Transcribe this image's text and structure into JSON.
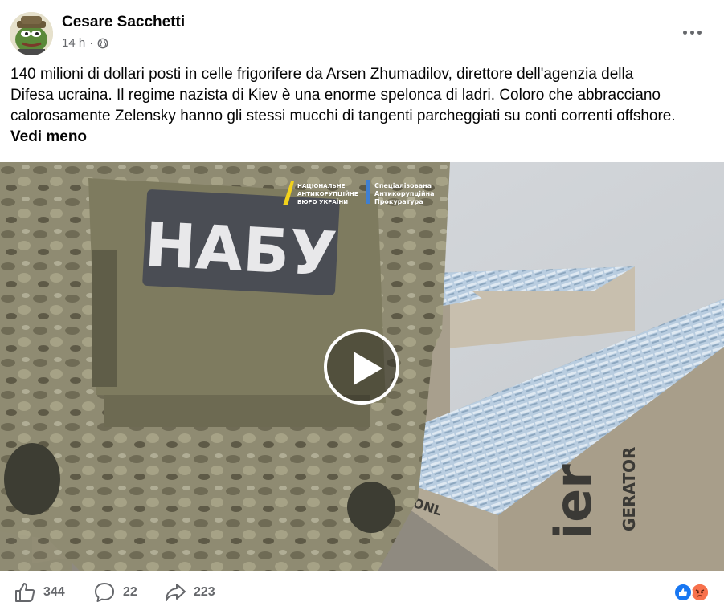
{
  "post": {
    "author": "Cesare Sacchetti",
    "time": "14 h",
    "separator": "·",
    "privacy_icon": "globe-icon",
    "more_icon": "more-horizontal-icon",
    "text_lines": [
      "140 milioni di dollari posti in celle frigorifere da Arsen Zhumadilov, direttore dell'agenzia della",
      "Difesa ucraina. Il regime nazista di Kiev è una enorme spelonca di ladri. Coloro che abbracciano",
      "calorosamente Zelensky hanno gli stessi mucchi di tangenti parcheggiati su conti correnti offshore."
    ],
    "see_less": "Vedi meno"
  },
  "video": {
    "patch_text": "НАБУ",
    "logo1_lines": [
      "НАЦІОНАЛЬНЕ",
      "АНТИКОРУПЦІЙНЕ",
      "БЮРО УКРАЇНИ"
    ],
    "logo2_lines": [
      "Спеціалізована",
      "Антикорупційна",
      "Прокуратура"
    ],
    "box_text_1": "DONL",
    "box_text_2": "ier",
    "box_text_3": "GERATOR",
    "play_icon": "play-icon"
  },
  "actions": {
    "likes": "344",
    "comments": "22",
    "shares": "223",
    "like_icon": "thumbs-up-icon",
    "comment_icon": "comment-icon",
    "share_icon": "share-icon",
    "reactions": [
      "like-reaction-icon",
      "angry-reaction-icon"
    ]
  },
  "colors": {
    "text": "#050505",
    "secondary": "#65676b",
    "like_blue": "#1877f2",
    "angry_orange": "#f7714c"
  }
}
